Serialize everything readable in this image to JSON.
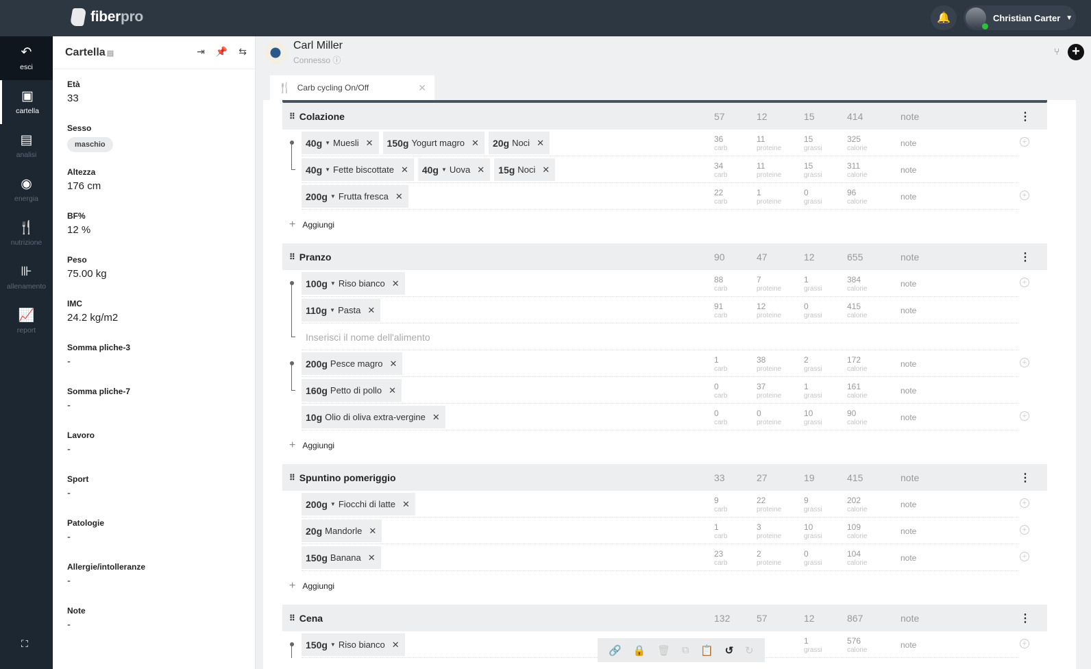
{
  "brand": {
    "name_a": "fiber",
    "name_b": "pro"
  },
  "user": {
    "name": "Christian Carter"
  },
  "nav": [
    {
      "label": "esci",
      "icon": "↶"
    },
    {
      "label": "cartella",
      "icon": "▣"
    },
    {
      "label": "analisi",
      "icon": "▤"
    },
    {
      "label": "energia",
      "icon": "◉"
    },
    {
      "label": "nutrizione",
      "icon": "🍴"
    },
    {
      "label": "allenamento",
      "icon": "⊪"
    },
    {
      "label": "report",
      "icon": "📈"
    }
  ],
  "panel": {
    "title": "Cartella",
    "fields": [
      {
        "label": "Età",
        "value": "33"
      },
      {
        "label": "Sesso",
        "value": "maschio",
        "pill": true
      },
      {
        "label": "Altezza",
        "value": "176 cm"
      },
      {
        "label": "BF%",
        "value": "12 %"
      },
      {
        "label": "Peso",
        "value": "75.00 kg"
      },
      {
        "label": "IMC",
        "value": "24.2 kg/m2"
      },
      {
        "label": "Somma pliche-3",
        "value": "-"
      },
      {
        "label": "Somma pliche-7",
        "value": "-"
      },
      {
        "label": "Lavoro",
        "value": "-"
      },
      {
        "label": "Sport",
        "value": "-"
      },
      {
        "label": "Patologie",
        "value": "-"
      },
      {
        "label": "Allergie/intolleranze",
        "value": "-"
      },
      {
        "label": "Note",
        "value": "-"
      }
    ]
  },
  "client": {
    "name": "Carl Miller",
    "status": "Connesso"
  },
  "tab": {
    "label": "Carb cycling On/Off"
  },
  "labels": {
    "carb": "carb",
    "prot": "proteine",
    "fat": "grassi",
    "cal": "calorie",
    "note": "note",
    "add": "Aggiungi"
  },
  "meals": [
    {
      "name": "Colazione",
      "totals": [
        "57",
        "12",
        "15",
        "414"
      ],
      "rows": [
        {
          "chips": [
            {
              "q": "40g",
              "dd": true,
              "n": "Muesli"
            },
            {
              "q": "150g",
              "n": "Yogurt magro"
            },
            {
              "q": "20g",
              "n": "Noci"
            }
          ],
          "v": [
            "36",
            "11",
            "15",
            "325"
          ],
          "plus": true,
          "link": "start"
        },
        {
          "chips": [
            {
              "q": "40g",
              "dd": true,
              "n": "Fette biscottate"
            },
            {
              "q": "40g",
              "dd": true,
              "n": "Uova"
            },
            {
              "q": "15g",
              "n": "Noci"
            }
          ],
          "v": [
            "34",
            "11",
            "15",
            "311"
          ],
          "link": "end"
        },
        {
          "chips": [
            {
              "q": "200g",
              "dd": true,
              "n": "Frutta fresca"
            }
          ],
          "v": [
            "22",
            "1",
            "0",
            "96"
          ],
          "plus": true
        }
      ]
    },
    {
      "name": "Pranzo",
      "totals": [
        "90",
        "47",
        "12",
        "655"
      ],
      "rows": [
        {
          "chips": [
            {
              "q": "100g",
              "dd": true,
              "n": "Riso bianco"
            }
          ],
          "v": [
            "88",
            "7",
            "1",
            "384"
          ],
          "plus": true,
          "link": "start"
        },
        {
          "chips": [
            {
              "q": "110g",
              "dd": true,
              "n": "Pasta"
            }
          ],
          "v": [
            "91",
            "12",
            "0",
            "415"
          ],
          "link": "mid"
        },
        {
          "input": "Inserisci il nome dell'alimento",
          "link": "end"
        },
        {
          "chips": [
            {
              "q": "200g",
              "n": "Pesce magro"
            }
          ],
          "v": [
            "1",
            "38",
            "2",
            "172"
          ],
          "plus": true,
          "link": "start"
        },
        {
          "chips": [
            {
              "q": "160g",
              "n": "Petto di pollo"
            }
          ],
          "v": [
            "0",
            "37",
            "1",
            "161"
          ],
          "link": "end"
        },
        {
          "chips": [
            {
              "q": "10g",
              "n": "Olio di oliva extra-vergine"
            }
          ],
          "v": [
            "0",
            "0",
            "10",
            "90"
          ],
          "plus": true
        }
      ]
    },
    {
      "name": "Spuntino pomeriggio",
      "totals": [
        "33",
        "27",
        "19",
        "415"
      ],
      "rows": [
        {
          "chips": [
            {
              "q": "200g",
              "dd": true,
              "n": "Fiocchi di latte"
            }
          ],
          "v": [
            "9",
            "22",
            "9",
            "202"
          ],
          "plus": true
        },
        {
          "chips": [
            {
              "q": "20g",
              "n": "Mandorle"
            }
          ],
          "v": [
            "1",
            "3",
            "10",
            "109"
          ],
          "plus": true
        },
        {
          "chips": [
            {
              "q": "150g",
              "n": "Banana"
            }
          ],
          "v": [
            "23",
            "2",
            "0",
            "104"
          ],
          "plus": true
        }
      ]
    },
    {
      "name": "Cena",
      "totals": [
        "132",
        "57",
        "12",
        "867"
      ],
      "rows": [
        {
          "chips": [
            {
              "q": "150g",
              "dd": true,
              "n": "Riso bianco"
            }
          ],
          "v": [
            "",
            "",
            "1",
            "576"
          ],
          "plus": true,
          "link": "start"
        }
      ],
      "noadd": true
    }
  ],
  "toolbar": [
    {
      "icon": "link-icon",
      "g": "🔗",
      "on": true
    },
    {
      "icon": "lock-icon",
      "g": "🔒"
    },
    {
      "icon": "trash-icon",
      "g": "🗑"
    },
    {
      "icon": "copy-icon",
      "g": "⧉"
    },
    {
      "icon": "paste-icon",
      "g": "📋"
    },
    {
      "icon": "undo-icon",
      "g": "↺",
      "on": true
    },
    {
      "icon": "redo-icon",
      "g": "↻"
    }
  ]
}
